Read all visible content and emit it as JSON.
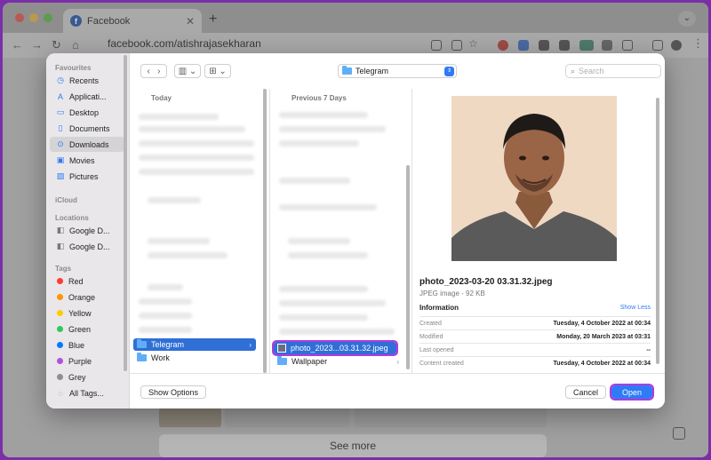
{
  "browser": {
    "tab_title": "Facebook",
    "fb_glyph": "f",
    "url": "facebook.com/atishrajasekharan",
    "page_button": "See more",
    "colors": {
      "accent": "#2f7bf6",
      "highlight": "#b03adf",
      "frame_bg": "#7b2fa6"
    }
  },
  "sidebar": {
    "favourites_label": "Favourites",
    "favourites": [
      {
        "label": "Recents",
        "icon": "clock-icon"
      },
      {
        "label": "Applicati...",
        "icon": "applications-icon"
      },
      {
        "label": "Desktop",
        "icon": "desktop-icon"
      },
      {
        "label": "Documents",
        "icon": "document-icon"
      },
      {
        "label": "Downloads",
        "icon": "download-icon"
      },
      {
        "label": "Movies",
        "icon": "film-icon"
      },
      {
        "label": "Pictures",
        "icon": "picture-icon"
      }
    ],
    "icloud_label": "iCloud",
    "locations_label": "Locations",
    "locations": [
      {
        "label": "Google D...",
        "icon": "drive-icon"
      },
      {
        "label": "Google D...",
        "icon": "drive-icon"
      }
    ],
    "tags_label": "Tags",
    "tags": [
      {
        "label": "Red",
        "color": "#ff3b30"
      },
      {
        "label": "Orange",
        "color": "#ff9500"
      },
      {
        "label": "Yellow",
        "color": "#ffcc00"
      },
      {
        "label": "Green",
        "color": "#34c759"
      },
      {
        "label": "Blue",
        "color": "#007aff"
      },
      {
        "label": "Purple",
        "color": "#af52de"
      },
      {
        "label": "Grey",
        "color": "#8e8e93"
      }
    ],
    "all_tags": "All Tags..."
  },
  "toolbar": {
    "location": "Telegram",
    "search_placeholder": "Search"
  },
  "columns": {
    "col1_header": "Today",
    "col1_items": [
      "Telegram",
      "Work"
    ],
    "col2_header": "Previous 7 Days",
    "col2_items": [
      "photo_2023...03.31.32.jpeg",
      "Wallpaper"
    ]
  },
  "preview": {
    "filename": "photo_2023-03-20 03.31.32.jpeg",
    "type": "JPEG image - 92 KB",
    "info_title": "Information",
    "show_less": "Show Less",
    "rows": [
      {
        "label": "Created",
        "value": "Tuesday, 4 October 2022 at 00:34"
      },
      {
        "label": "Modified",
        "value": "Monday, 20 March 2023 at 03:31"
      },
      {
        "label": "Last opened",
        "value": "--"
      },
      {
        "label": "Content created",
        "value": "Tuesday, 4 October 2022 at 00:34"
      }
    ]
  },
  "footer": {
    "show_options": "Show Options",
    "cancel": "Cancel",
    "open": "Open"
  }
}
